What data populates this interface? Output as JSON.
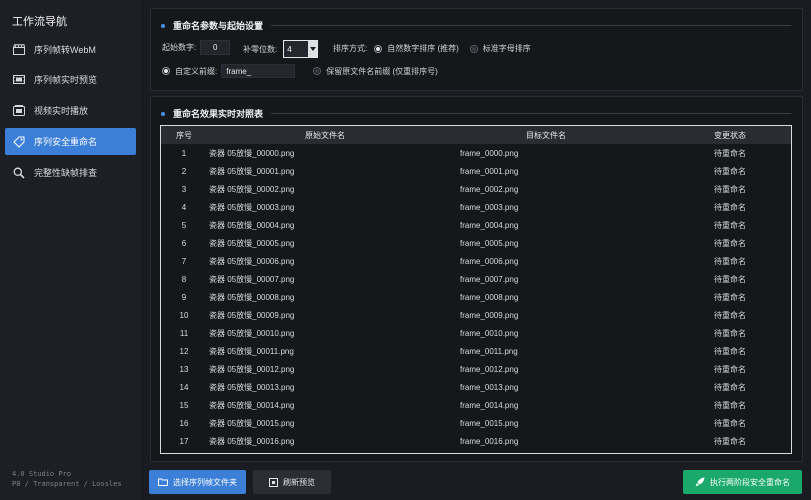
{
  "sidebar": {
    "title": "工作流导航",
    "items": [
      {
        "label": "序列帧转WebM",
        "icon": "clapperboard-icon"
      },
      {
        "label": "序列帧实时预览",
        "icon": "film-icon"
      },
      {
        "label": "视频实时播放",
        "icon": "video-player-icon"
      },
      {
        "label": "序列安全重命名",
        "icon": "tag-icon",
        "active": true
      },
      {
        "label": "完整性缺帧排查",
        "icon": "search-icon"
      }
    ],
    "footer_line1": "4.0 Studio Pro",
    "footer_line2": "P8 / Transparent / Lossles"
  },
  "params": {
    "title": "重命名参数与起始设置",
    "start_label": "起始数字:",
    "start_value": "0",
    "pad_label": "补零位数:",
    "pad_value": "4",
    "sort_label": "排序方式:",
    "sort_natural": "自然数字排序 (推荐)",
    "sort_standard": "标准字母排序",
    "custom_prefix_label": "自定义前缀:",
    "custom_prefix_value": "frame_",
    "keep_prefix_label": "保留原文件名前缀 (仅重排序号)"
  },
  "preview": {
    "title": "重命名效果实时对照表",
    "columns": [
      "序号",
      "原始文件名",
      "目标文件名",
      "变更状态"
    ],
    "rows": [
      [
        "1",
        "瓷器 05放慢_00000.png",
        "frame_0000.png",
        "待重命名"
      ],
      [
        "2",
        "瓷器 05放慢_00001.png",
        "frame_0001.png",
        "待重命名"
      ],
      [
        "3",
        "瓷器 05放慢_00002.png",
        "frame_0002.png",
        "待重命名"
      ],
      [
        "4",
        "瓷器 05放慢_00003.png",
        "frame_0003.png",
        "待重命名"
      ],
      [
        "5",
        "瓷器 05放慢_00004.png",
        "frame_0004.png",
        "待重命名"
      ],
      [
        "6",
        "瓷器 05放慢_00005.png",
        "frame_0005.png",
        "待重命名"
      ],
      [
        "7",
        "瓷器 05放慢_00006.png",
        "frame_0006.png",
        "待重命名"
      ],
      [
        "8",
        "瓷器 05放慢_00007.png",
        "frame_0007.png",
        "待重命名"
      ],
      [
        "9",
        "瓷器 05放慢_00008.png",
        "frame_0008.png",
        "待重命名"
      ],
      [
        "10",
        "瓷器 05放慢_00009.png",
        "frame_0009.png",
        "待重命名"
      ],
      [
        "11",
        "瓷器 05放慢_00010.png",
        "frame_0010.png",
        "待重命名"
      ],
      [
        "12",
        "瓷器 05放慢_00011.png",
        "frame_0011.png",
        "待重命名"
      ],
      [
        "13",
        "瓷器 05放慢_00012.png",
        "frame_0012.png",
        "待重命名"
      ],
      [
        "14",
        "瓷器 05放慢_00013.png",
        "frame_0013.png",
        "待重命名"
      ],
      [
        "15",
        "瓷器 05放慢_00014.png",
        "frame_0014.png",
        "待重命名"
      ],
      [
        "16",
        "瓷器 05放慢_00015.png",
        "frame_0015.png",
        "待重命名"
      ],
      [
        "17",
        "瓷器 05放慢_00016.png",
        "frame_0016.png",
        "待重命名"
      ]
    ]
  },
  "actions": {
    "select_folder": "选择序列帧文件夹",
    "refresh": "刷新预览",
    "execute": "执行两阶段安全重命名"
  },
  "colors": {
    "accent": "#3c7fd8",
    "execute": "#1aa86b",
    "background": "#1a1c22"
  }
}
